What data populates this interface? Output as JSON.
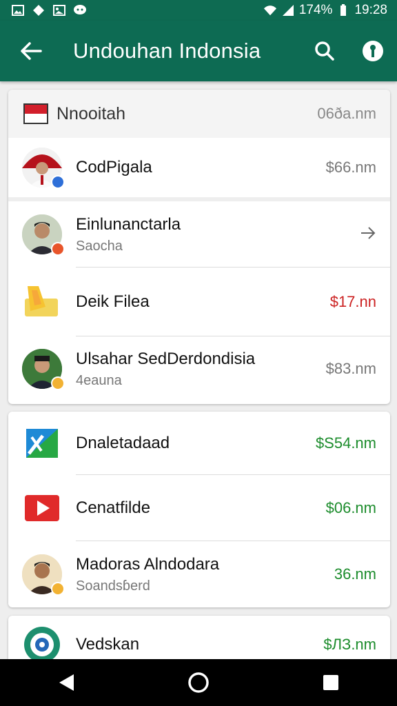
{
  "status_bar": {
    "battery": "174%",
    "time": "19:28"
  },
  "app_bar": {
    "title": "Undouhan Indonsia",
    "back_icon": "arrow-left-icon",
    "search_icon": "search-icon",
    "info_icon": "info-icon"
  },
  "section1": {
    "header": {
      "title": "Nnooitah",
      "time": "06ða.nm"
    },
    "rows": [
      {
        "name": "CodPigala",
        "amount": "$66.nm"
      },
      {
        "name": "Einlunanctarla",
        "sub": "Saocha"
      },
      {
        "name": "Deik Filea",
        "amount": "$17.nn"
      },
      {
        "name": "Ulsahar SedDerdondisia",
        "sub": "4eauna",
        "amount": "$83.nm"
      }
    ]
  },
  "section2": {
    "rows": [
      {
        "name": "Dnaletadaad",
        "amount": "$S54.nm"
      },
      {
        "name": "Cenatfilde",
        "amount": "$06.nm"
      },
      {
        "name": "Madoras Alndodara",
        "sub": "Soandsɓerd",
        "amount": "36.nm"
      }
    ]
  },
  "section3": {
    "rows": [
      {
        "name": "Vedskan",
        "amount": "$ЛЗ.nm"
      }
    ]
  },
  "colors": {
    "accent": "#0d6b53",
    "negative": "#cc2222",
    "positive": "#1c8c2c"
  }
}
